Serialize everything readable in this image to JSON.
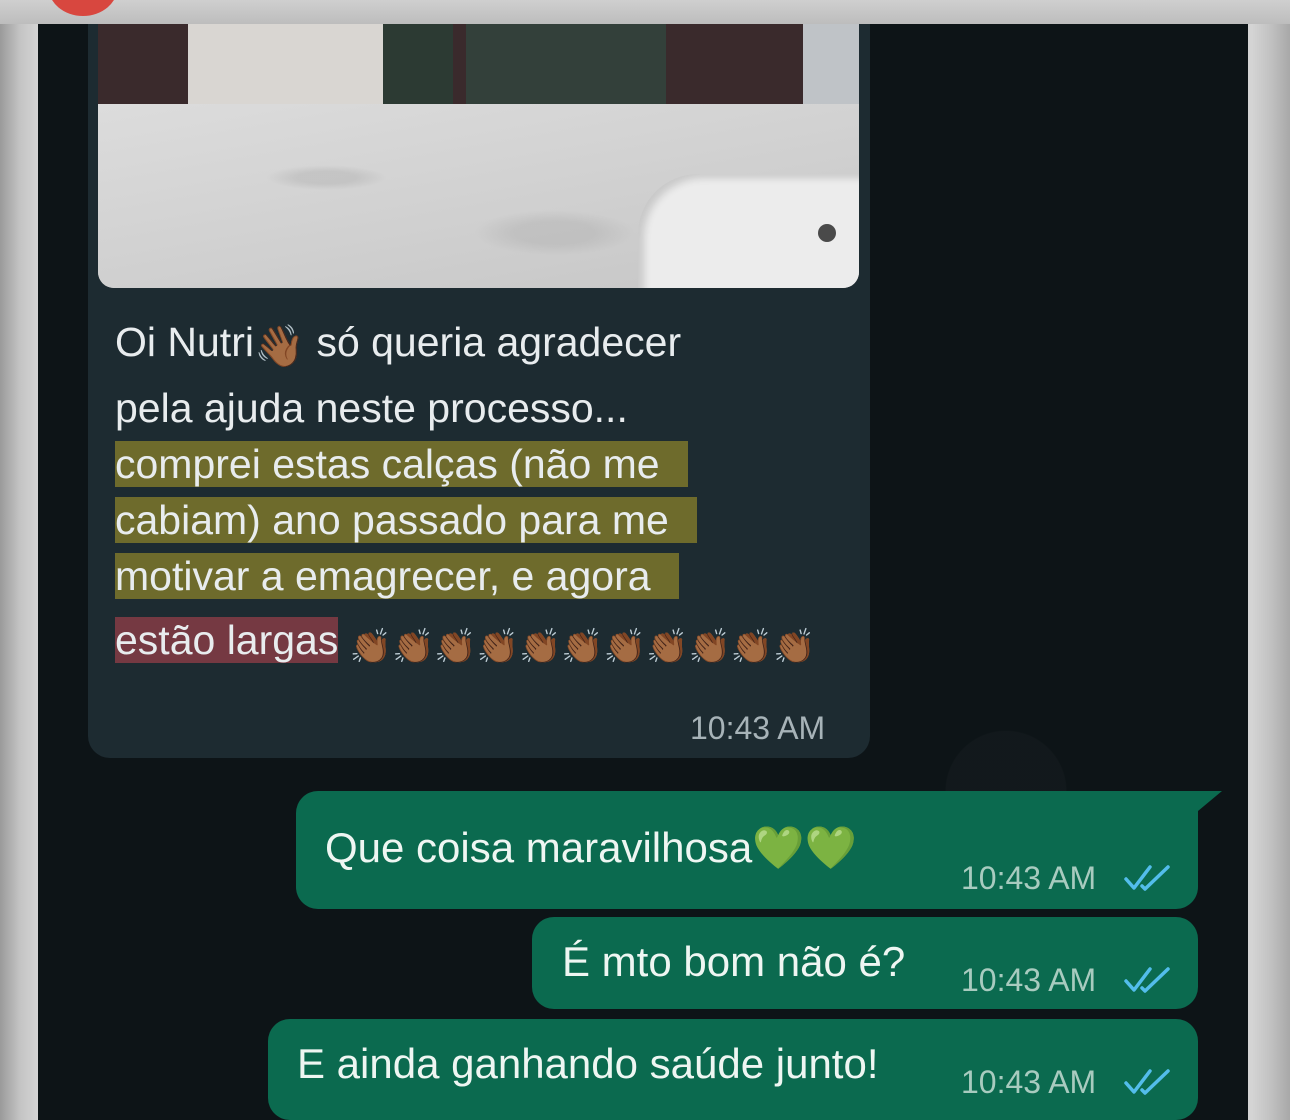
{
  "incoming": {
    "lines": [
      "Oi Nutri",
      "só queria agradecer",
      "pela ajuda neste processo...",
      "comprei estas calças (não me",
      "cabiam) ano passado para me",
      "motivar a emagrecer, e agora",
      "estão largas"
    ],
    "wave_emoji": "👋🏾",
    "clap_emojis": "👏🏾👏🏾👏🏾👏🏾👏🏾👏🏾👏🏾👏🏾👏🏾👏🏾👏🏾",
    "time": "10:43 AM",
    "highlight_color": "#b0a028",
    "highlight_red_color": "#be4650"
  },
  "outgoing": [
    {
      "text": "Que coisa maravilhosa",
      "emoji": "💚💚",
      "time": "10:43 AM",
      "status": "read"
    },
    {
      "text": "É mto bom não é?",
      "time": "10:43 AM",
      "status": "read"
    },
    {
      "text": "E ainda ganhando saúde junto!",
      "time": "10:43 AM",
      "status": "read"
    }
  ],
  "colors": {
    "chat_bg": "#0d1417",
    "incoming_bubble": "#1d2b31",
    "outgoing_bubble": "#0b6a4f",
    "read_ticks": "#53bdeb"
  },
  "icons": [
    "double-check-icon",
    "heart-emoji",
    "wave-emoji",
    "clap-emoji"
  ]
}
